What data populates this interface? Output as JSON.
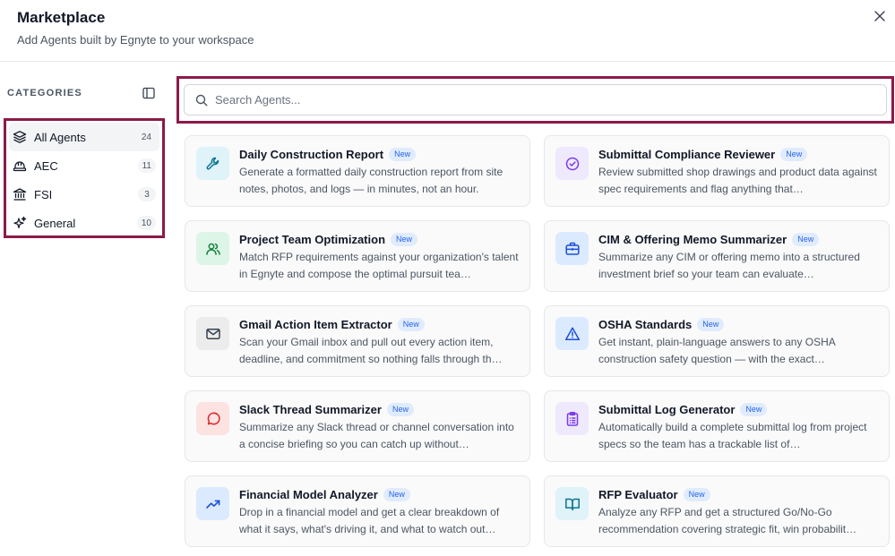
{
  "header": {
    "title": "Marketplace",
    "subtitle": "Add Agents built by Egnyte to your workspace"
  },
  "sidebar": {
    "heading": "CATEGORIES",
    "categories": [
      {
        "label": "All Agents",
        "count": "24",
        "icon": "layers-icon",
        "active": true
      },
      {
        "label": "AEC",
        "count": "11",
        "icon": "hard-hat-icon"
      },
      {
        "label": "FSI",
        "count": "3",
        "icon": "bank-icon"
      },
      {
        "label": "General",
        "count": "10",
        "icon": "sparkles-icon"
      }
    ]
  },
  "search": {
    "placeholder": "Search Agents..."
  },
  "colors": {
    "highlight_border": "#8b1a4a",
    "badge_text": "#2563eb",
    "badge_bg": "#e0ecfd"
  },
  "agents": [
    {
      "title": "Daily Construction Report",
      "badge": "New",
      "description": "Generate a formatted daily construction report from site notes, photos, and logs — in minutes, not an hour.",
      "icon": "wrench-icon",
      "icon_bg": "#dff3f9",
      "icon_color": "#0e7490"
    },
    {
      "title": "Submittal Compliance Reviewer",
      "badge": "New",
      "description": "Review submitted shop drawings and product data against spec requirements and flag anything that…",
      "icon": "check-circle-icon",
      "icon_bg": "#efe9fd",
      "icon_color": "#7c3aed"
    },
    {
      "title": "Project Team Optimization",
      "badge": "New",
      "description": "Match RFP requirements against your organization's talent in Egnyte and compose the optimal pursuit tea…",
      "icon": "users-icon",
      "icon_bg": "#dcf5e6",
      "icon_color": "#15803d"
    },
    {
      "title": "CIM & Offering Memo Summarizer",
      "badge": "New",
      "description": "Summarize any CIM or offering memo into a structured investment brief so your team can evaluate…",
      "icon": "briefcase-icon",
      "icon_bg": "#dbeafe",
      "icon_color": "#1d4ed8"
    },
    {
      "title": "Gmail Action Item Extractor",
      "badge": "New",
      "description": "Scan your Gmail inbox and pull out every action item, deadline, and commitment so nothing falls through th…",
      "icon": "mail-icon",
      "icon_bg": "#ececec",
      "icon_color": "#374151"
    },
    {
      "title": "OSHA Standards",
      "badge": "New",
      "description": "Get instant, plain-language answers to any OSHA construction safety question — with the exact…",
      "icon": "warning-triangle-icon",
      "icon_bg": "#dbeafe",
      "icon_color": "#1d4ed8"
    },
    {
      "title": "Slack Thread Summarizer",
      "badge": "New",
      "description": "Summarize any Slack thread or channel conversation into a concise briefing so you can catch up without…",
      "icon": "chat-bubble-icon",
      "icon_bg": "#fde2e2",
      "icon_color": "#dc2626"
    },
    {
      "title": "Submittal Log Generator",
      "badge": "New",
      "description": "Automatically build a complete submittal log from project specs so the team has a trackable list of…",
      "icon": "clipboard-list-icon",
      "icon_bg": "#efe9fd",
      "icon_color": "#7c3aed"
    },
    {
      "title": "Financial Model Analyzer",
      "badge": "New",
      "description": "Drop in a financial model and get a clear breakdown of what it says, what's driving it, and what to watch out…",
      "icon": "trending-up-icon",
      "icon_bg": "#dbeafe",
      "icon_color": "#1d4ed8"
    },
    {
      "title": "RFP Evaluator",
      "badge": "New",
      "description": "Analyze any RFP and get a structured Go/No-Go recommendation covering strategic fit, win probabilit…",
      "icon": "open-book-icon",
      "icon_bg": "#dff3f9",
      "icon_color": "#0e7490"
    }
  ]
}
